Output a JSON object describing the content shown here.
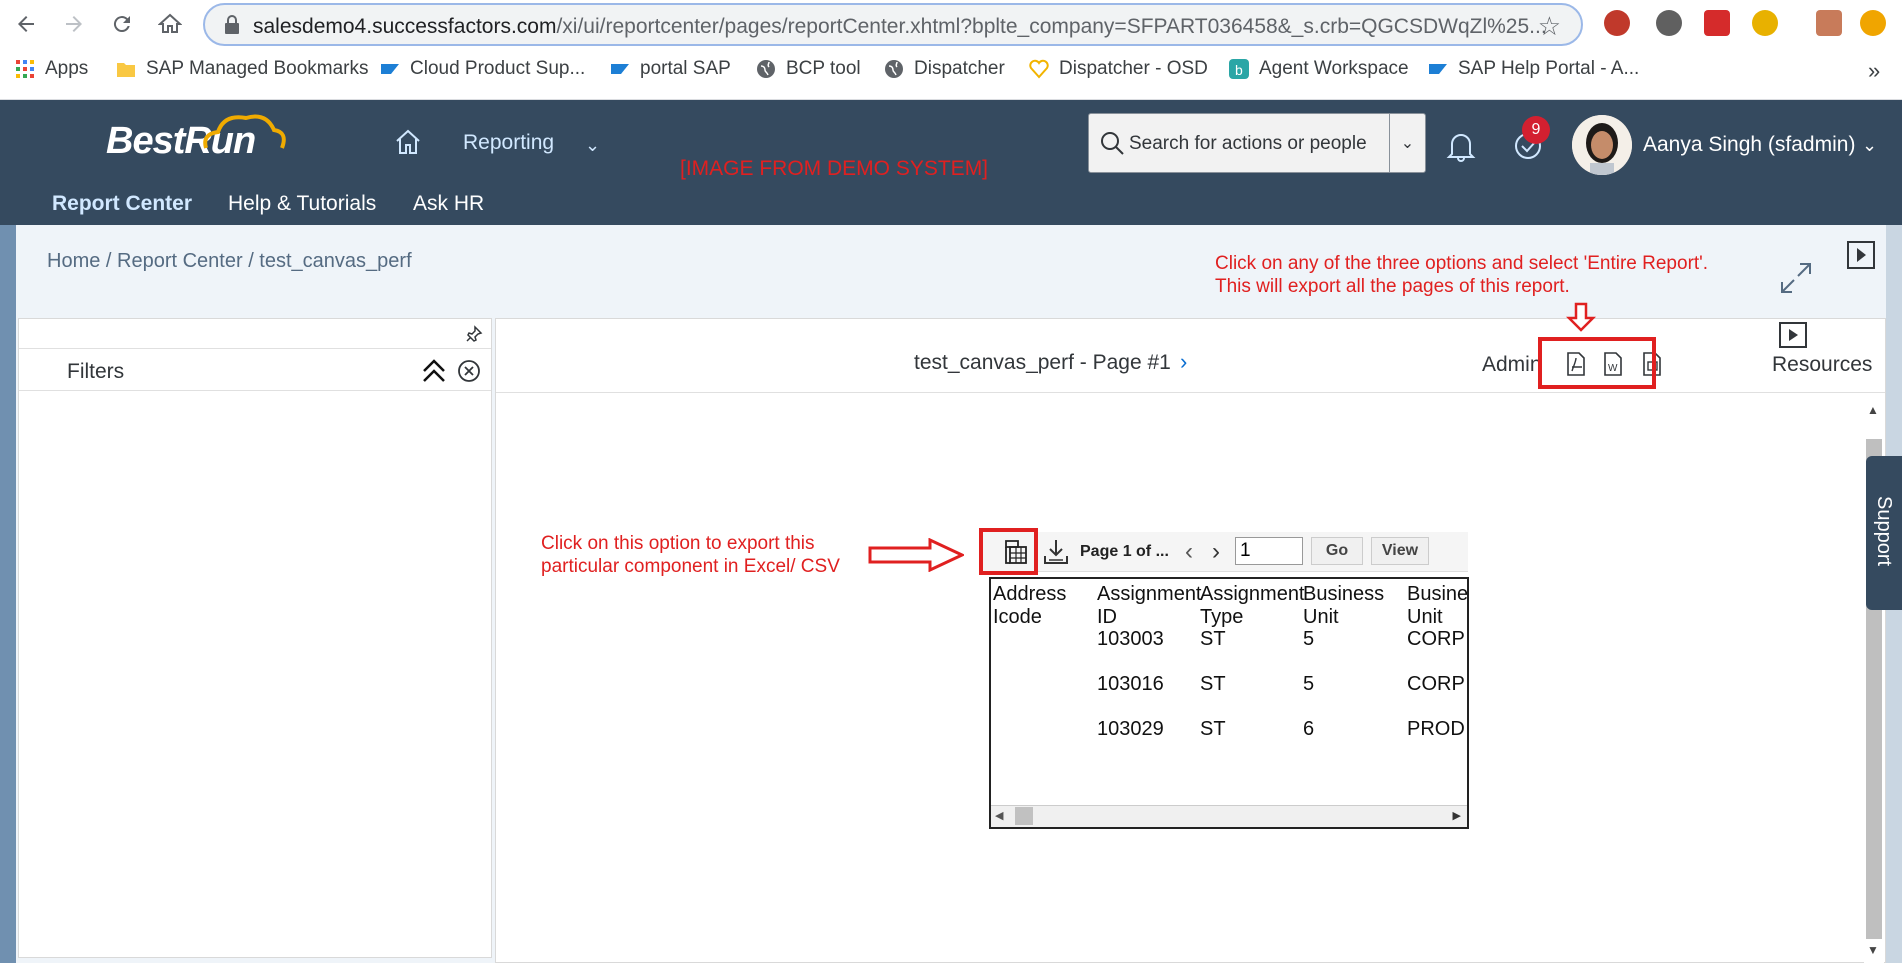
{
  "browser": {
    "url_host": "salesdemo4.successfactors.com",
    "url_rest": "/xi/ui/reportcenter/pages/reportCenter.xhtml?bplte_company=SFPART036458&_s.crb=QGCSDWqZl%25...",
    "bookmarks": [
      {
        "label": "Apps",
        "icon": "apps-grid-icon"
      },
      {
        "label": "SAP Managed Bookmarks",
        "icon": "folder-icon"
      },
      {
        "label": "Cloud Product Sup...",
        "icon": "sap-icon"
      },
      {
        "label": "portal SAP",
        "icon": "sap-icon"
      },
      {
        "label": "BCP tool",
        "icon": "globe-icon"
      },
      {
        "label": "Dispatcher",
        "icon": "globe-icon"
      },
      {
        "label": "Dispatcher - OSD",
        "icon": "heart-icon"
      },
      {
        "label": "Agent Workspace",
        "icon": "b-icon"
      },
      {
        "label": "SAP Help Portal - A...",
        "icon": "sap-icon"
      }
    ],
    "more_bookmarks": "»"
  },
  "header": {
    "logo": "BestRun",
    "menu": "Reporting",
    "watermark": "[IMAGE FROM DEMO SYSTEM]",
    "search_placeholder": "Search for actions or people",
    "notification_count": "9",
    "user": "Aanya Singh (sfadmin)",
    "subnav": [
      "Report Center",
      "Help & Tutorials",
      "Ask HR"
    ]
  },
  "breadcrumb": "Home / Report Center / test_canvas_perf",
  "instructions": {
    "top_line1": "Click on any of the three options and select 'Entire Report'.",
    "top_line2": "This will export all the pages of this report.",
    "left_line1": "Click on this option to export this",
    "left_line2": "particular component in Excel/ CSV"
  },
  "filters": {
    "title": "Filters"
  },
  "report": {
    "title": "test_canvas_perf - Page #1",
    "admin": "Admin",
    "resources": "Resources",
    "support": "Support"
  },
  "component": {
    "page_label": "Page 1 of ...",
    "page_input": "1",
    "go": "Go",
    "view": "View",
    "headers": [
      [
        "Address",
        "Icode"
      ],
      [
        "Assignment",
        "ID"
      ],
      [
        "Assignment",
        "Type"
      ],
      [
        "Business",
        "Unit"
      ],
      [
        "Busine",
        "Unit"
      ]
    ],
    "rows": [
      [
        "",
        "103003",
        "ST",
        "5",
        "CORP"
      ],
      [
        "",
        "103016",
        "ST",
        "5",
        "CORP"
      ],
      [
        "",
        "103029",
        "ST",
        "6",
        "PROD"
      ]
    ]
  },
  "colors": {
    "shell": "#354a5f",
    "annotation": "#e02020",
    "link": "#0a6ed1"
  }
}
